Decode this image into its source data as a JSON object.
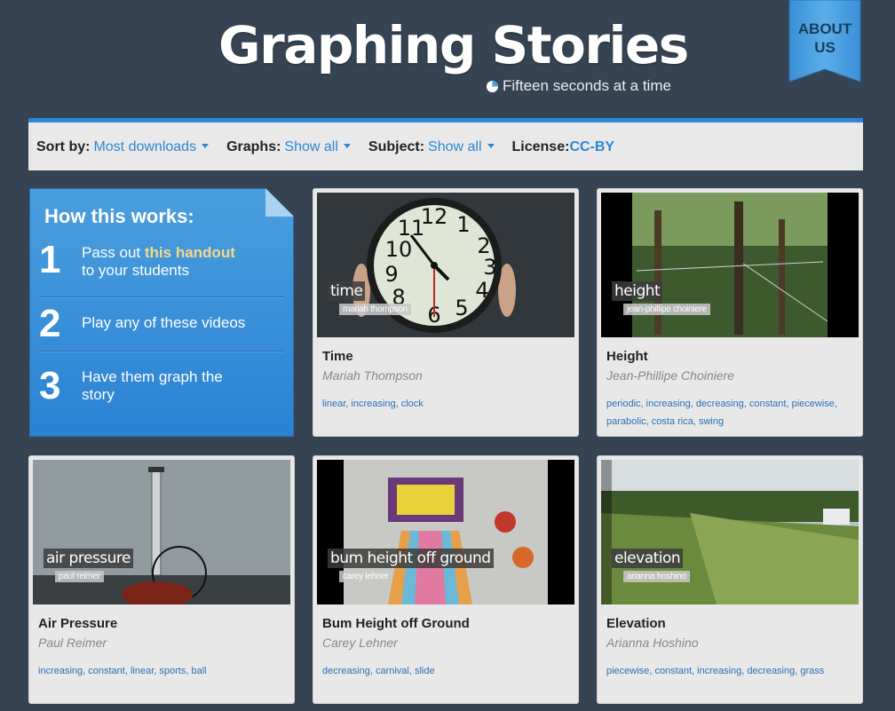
{
  "header": {
    "title": "Graphing Stories",
    "subtitle": "Fifteen seconds at a time",
    "about_label_line1": "ABOUT",
    "about_label_line2": "US"
  },
  "filters": {
    "sort_label": "Sort by:",
    "sort_value": "Most downloads",
    "graphs_label": "Graphs:",
    "graphs_value": "Show all",
    "subject_label": "Subject:",
    "subject_value": "Show all",
    "license_label": "License:",
    "license_value": "CC-BY"
  },
  "howto": {
    "title": "How this works:",
    "steps": [
      {
        "num": "1",
        "text_before": "Pass out ",
        "link": "this handout",
        "text_after": "to your students"
      },
      {
        "num": "2",
        "text": "Play any of these videos"
      },
      {
        "num": "3",
        "text": "Have them graph the story"
      }
    ]
  },
  "videos": [
    {
      "title": "Time",
      "author": "Mariah Thompson",
      "caption_title": "time",
      "caption_author": "mariah thompson",
      "tags": [
        "linear",
        "increasing",
        "clock"
      ]
    },
    {
      "title": "Height",
      "author": "Jean-Phillipe Choiniere",
      "caption_title": "height",
      "caption_author": "jean-phillipe choiniere",
      "tags": [
        "periodic",
        "increasing",
        "decreasing",
        "constant",
        "piecewise",
        "parabolic",
        "costa rica",
        "swing"
      ]
    },
    {
      "title": "Air Pressure",
      "author": "Paul Reimer",
      "caption_title": "air pressure",
      "caption_author": "paul reimer",
      "tags": [
        "increasing",
        "constant",
        "linear",
        "sports",
        "ball"
      ]
    },
    {
      "title": "Bum Height off Ground",
      "author": "Carey Lehner",
      "caption_title": "bum height off ground",
      "caption_author": "carey lehner",
      "tags": [
        "decreasing",
        "carnival",
        "slide"
      ]
    },
    {
      "title": "Elevation",
      "author": "Arianna Hoshino",
      "caption_title": "elevation",
      "caption_author": "arianna hoshino",
      "tags": [
        "piecewise",
        "constant",
        "increasing",
        "decreasing",
        "grass"
      ]
    }
  ],
  "colors": {
    "background": "#354352",
    "accent": "#2d86d6",
    "panel_blue": "#2a82d3",
    "handout_link": "#f5d98a"
  }
}
